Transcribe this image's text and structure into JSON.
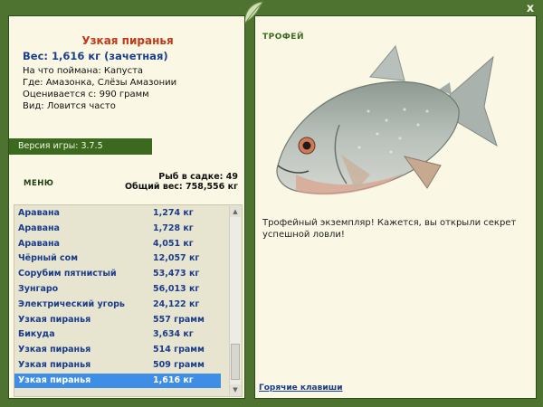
{
  "fish": {
    "name": "Узкая пиранья",
    "weight": "Вес: 1,616 кг (зачетная)",
    "bait": "На что поймана: Капуста",
    "location": "Где: Амазонка, Слёзы Амазонии",
    "value": "Оценивается с: 990 грамм",
    "kind": "Вид: Ловится часто"
  },
  "version": "Версия игры: 3.7.5",
  "menu_label": "МЕНЮ",
  "stats": {
    "fish_in_net": "Рыб в садке: 49",
    "total_weight": "Общий вес: 758,556 кг"
  },
  "catch_list": [
    {
      "name": "Аравана",
      "weight": "1,274 кг"
    },
    {
      "name": "Аравана",
      "weight": "1,728 кг"
    },
    {
      "name": "Аравана",
      "weight": "4,051 кг"
    },
    {
      "name": "Чёрный сом",
      "weight": "12,057 кг"
    },
    {
      "name": "Сорубим пятнистый",
      "weight": "53,473 кг"
    },
    {
      "name": "Зунгаро",
      "weight": "56,013 кг"
    },
    {
      "name": "Электрический угорь",
      "weight": "24,122 кг"
    },
    {
      "name": "Узкая пиранья",
      "weight": "557 грамм"
    },
    {
      "name": "Бикуда",
      "weight": "3,634 кг"
    },
    {
      "name": "Узкая пиранья",
      "weight": "514 грамм"
    },
    {
      "name": "Узкая пиранья",
      "weight": "509 грамм"
    },
    {
      "name": "Узкая пиранья",
      "weight": "1,616 кг"
    }
  ],
  "selected_index": 11,
  "trophy": {
    "label": "ТРОФЕЙ",
    "text": "Трофейный экземпляр! Кажется, вы открыли секрет успешной ловли!"
  },
  "hotkeys_label": "Горячие клавиши",
  "close_symbol": "x",
  "colors": {
    "frame": "#4e7230",
    "panel": "#faf8e4",
    "title_red": "#c0391b",
    "link_blue": "#1a3c8c",
    "selected_row": "#3e8ee6",
    "version_bar": "#3b6a1f"
  }
}
